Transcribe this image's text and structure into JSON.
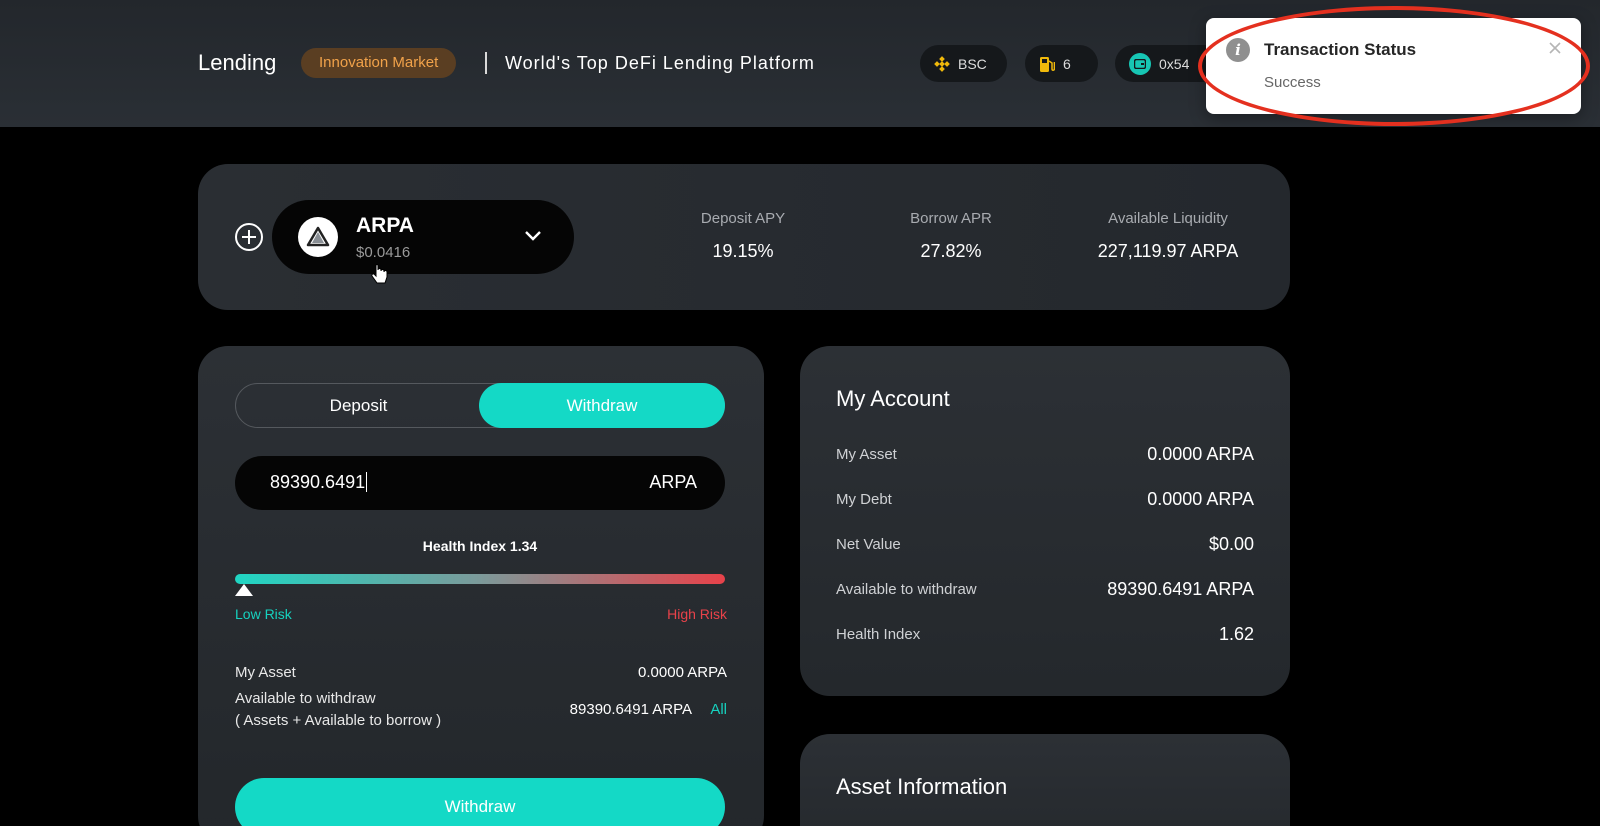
{
  "header": {
    "brand": "Lending",
    "market_badge": "Innovation Market",
    "tagline": "World's Top DeFi Lending Platform",
    "network": "BSC",
    "gas": "6",
    "address": "0x54"
  },
  "toast": {
    "icon": "info-icon",
    "title": "Transaction Status",
    "message": "Success"
  },
  "asset": {
    "symbol": "ARPA",
    "price": "$0.0416",
    "stats": [
      {
        "label": "Deposit APY",
        "value": "19.15%"
      },
      {
        "label": "Borrow APR",
        "value": "27.82%"
      },
      {
        "label": "Available Liquidity",
        "value": "227,119.97 ARPA"
      }
    ]
  },
  "action_panel": {
    "tabs": {
      "deposit": "Deposit",
      "withdraw": "Withdraw",
      "active": "Withdraw"
    },
    "amount": "89390.6491",
    "unit": "ARPA",
    "health_index_label": "Health Index 1.34",
    "health_index_level": 0.0,
    "low_risk": "Low Risk",
    "high_risk": "High Risk",
    "my_asset_label": "My Asset",
    "my_asset_value": "0.0000 ARPA",
    "available_label": "Available to withdraw",
    "available_sub": "( Assets + Available to borrow )",
    "available_value": "89390.6491 ARPA",
    "all_link": "All",
    "submit": "Withdraw"
  },
  "account": {
    "title": "My Account",
    "rows": [
      {
        "label": "My Asset",
        "value": "0.0000 ARPA"
      },
      {
        "label": "My Debt",
        "value": "0.0000 ARPA"
      },
      {
        "label": "Net Value",
        "value": "$0.00"
      },
      {
        "label": "Available to withdraw",
        "value": "89390.6491 ARPA"
      },
      {
        "label": "Health Index",
        "value": "1.62"
      }
    ]
  },
  "asset_info": {
    "title": "Asset Information"
  },
  "colors": {
    "accent": "#14d9c6",
    "danger": "#e8424a",
    "badge_text": "#f1a24a",
    "annotation": "#e4301f"
  }
}
